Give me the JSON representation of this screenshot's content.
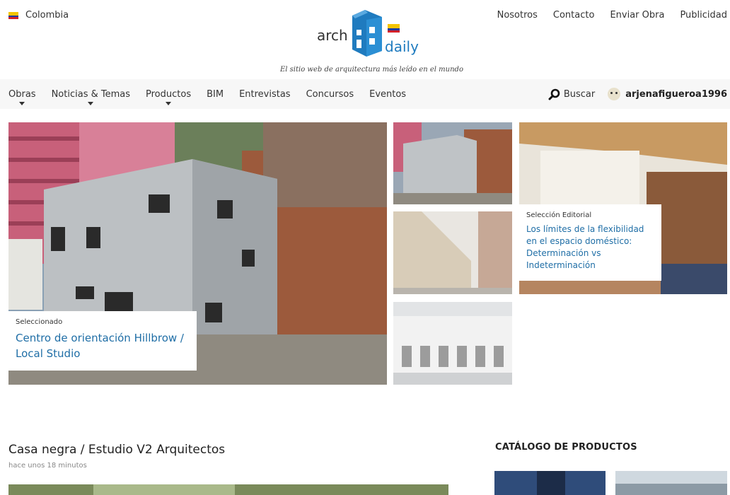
{
  "top": {
    "country": "Colombia",
    "links": [
      "Nosotros",
      "Contacto",
      "Enviar Obra",
      "Publicidad"
    ]
  },
  "logo": {
    "word1": "arch",
    "word2": "daily"
  },
  "tagline": "El sitio web de arquitectura más leído en el mundo",
  "nav": {
    "items": [
      {
        "label": "Obras",
        "dropdown": true
      },
      {
        "label": "Noticias & Temas",
        "dropdown": true
      },
      {
        "label": "Productos",
        "dropdown": true
      },
      {
        "label": "BIM",
        "dropdown": false
      },
      {
        "label": "Entrevistas",
        "dropdown": false
      },
      {
        "label": "Concursos",
        "dropdown": false
      },
      {
        "label": "Eventos",
        "dropdown": false
      }
    ],
    "search_label": "Buscar",
    "username": "arjenafigueroa1996"
  },
  "hero": {
    "main_label": "Seleccionado",
    "main_title": "Centro de orientación Hillbrow / Local Studio",
    "editorial_label": "Selección Editorial",
    "editorial_title": "Los límites de la flexibilidad en el espacio doméstico: Determinación vs Indeterminación"
  },
  "article": {
    "title": "Casa negra / Estudio V2 Arquitectos",
    "time": "hace unos 18 minutos"
  },
  "catalog": {
    "title": "CATÁLOGO DE PRODUCTOS"
  },
  "colors": {
    "link_blue": "#1f6ea6",
    "nav_bg": "#f7f7f7",
    "logo_blue": "#1f7bbf"
  },
  "icons": [
    "colombia-flag-icon",
    "caret-down-icon",
    "search-icon",
    "avatar"
  ]
}
